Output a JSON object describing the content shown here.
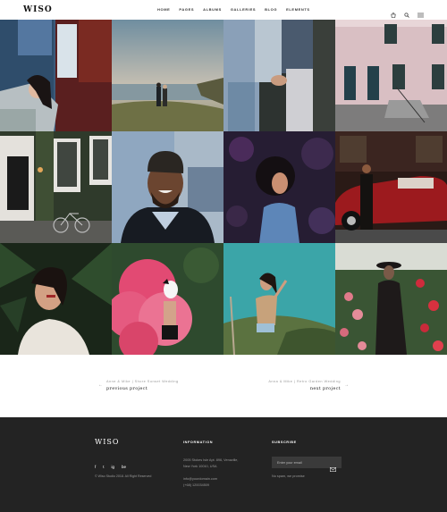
{
  "header": {
    "logo": "WISO",
    "nav": [
      "HOME",
      "PAGES",
      "ALBUMS",
      "GALLERIES",
      "BLOG",
      "ELEMENTS"
    ],
    "icons": [
      "cart-icon",
      "search-icon",
      "menu-icon"
    ]
  },
  "gallery": {
    "tiles": [
      "woman-by-window-photo",
      "couple-on-beach-photo",
      "couple-holding-hands-photo",
      "pink-building-photo",
      "house-with-bicycle-photo",
      "smiling-man-beanie-photo",
      "woman-in-flowers-photo",
      "man-with-red-car-photo",
      "woman-with-palms-photo",
      "pink-smoke-photo",
      "woman-on-hill-photo",
      "woman-in-roses-photo"
    ]
  },
  "project_nav": {
    "prev_small": "Anne & Mike | Shore Sunset Wedding",
    "prev_big": "previous project",
    "next_small": "Anna & Mike | Retro Garden Wedding",
    "next_big": "next project"
  },
  "footer": {
    "logo": "WISO",
    "social": [
      "f",
      "t",
      "ig",
      "be"
    ],
    "copyright": "© Wiso Studio 2018. All Right Reserved",
    "info_heading": "INFORMATION",
    "address_1": "2005 Stokes Isle Apt. 896, Venaville,",
    "address_2": "New York 10010, USA",
    "email": "info@yourdomain.com",
    "phone": "(+68) 120034509",
    "subscribe_heading": "SUBSCRIBE",
    "email_placeholder": "Enter your email",
    "spam_note": "No spam, we promise"
  }
}
